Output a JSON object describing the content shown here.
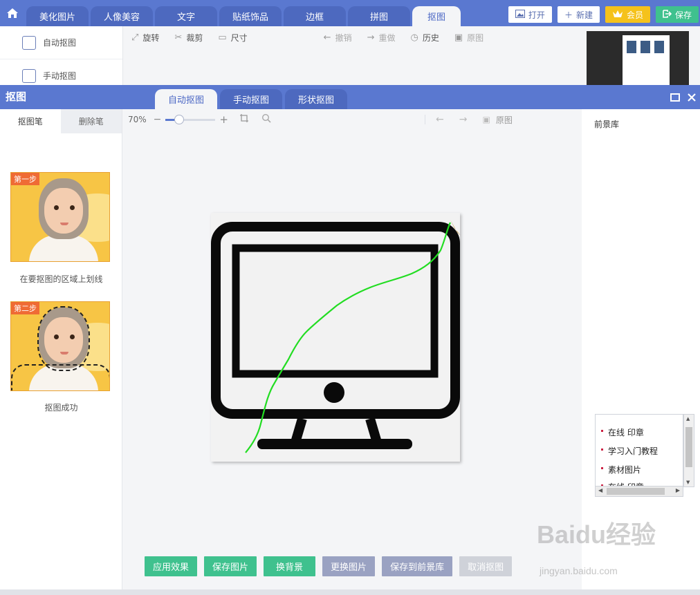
{
  "top_tabs": [
    {
      "label": "美化图片"
    },
    {
      "label": "人像美容"
    },
    {
      "label": "文字"
    },
    {
      "label": "贴纸饰品"
    },
    {
      "label": "边框"
    },
    {
      "label": "拼图"
    },
    {
      "label": "抠图"
    }
  ],
  "top_tabs_active": "抠图",
  "top_buttons": {
    "open": "打开",
    "new": "新建",
    "vip": "会员",
    "save": "保存"
  },
  "bg_sidebar": {
    "auto": "自动抠图",
    "manual": "手动抠图"
  },
  "bg_toolbar": {
    "rotate": "旋转",
    "crop": "裁剪",
    "size": "尺寸",
    "undo": "撤销",
    "redo": "重做",
    "history": "历史",
    "original": "原图"
  },
  "dialog": {
    "title": "抠图",
    "tabs": [
      {
        "label": "自动抠图"
      },
      {
        "label": "手动抠图"
      },
      {
        "label": "形状抠图"
      }
    ],
    "active_tab": "自动抠图"
  },
  "left_panel": {
    "tab_pen": "抠图笔",
    "tab_erase": "删除笔",
    "step1_badge": "第一步",
    "step1_caption": "在要抠图的区域上划线",
    "step2_badge": "第二步",
    "step2_caption": "抠图成功"
  },
  "canvas_toolbar": {
    "zoom": "70%",
    "zoom_level": 0.2,
    "original": "原图"
  },
  "right_panel": {
    "title": "前景库"
  },
  "context_menu": {
    "items": [
      "在线 印章",
      "学习入门教程",
      "素材图片",
      "在线 印章"
    ]
  },
  "bottom_buttons": {
    "apply": "应用效果",
    "save_image": "保存图片",
    "change_bg": "换背景",
    "change_image": "更换图片",
    "save_foreground": "保存到前景库",
    "cancel": "取消抠图"
  },
  "watermark": {
    "brand": "Baidu经验",
    "url": "jingyan.baidu.com"
  },
  "colors": {
    "header_blue": "#5a78d0",
    "accent_green": "#3fc18e",
    "vip_gold": "#f5c21b",
    "stroke_green": "#22dd22",
    "gray_button": "#9aa2c2"
  }
}
